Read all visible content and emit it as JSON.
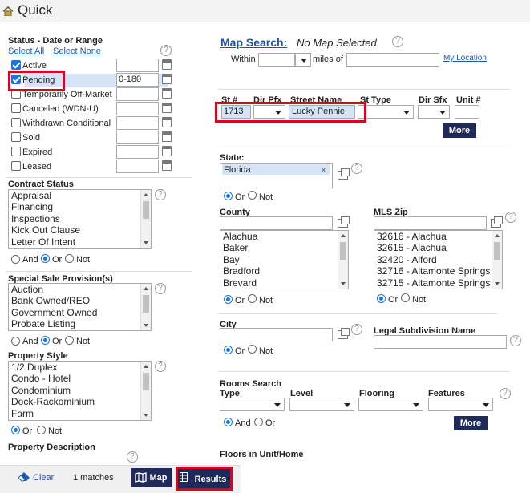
{
  "header": {
    "title": "Quick"
  },
  "status": {
    "title": "Status - Date or Range",
    "select_all": "Select All",
    "select_none": "Select None",
    "items": [
      {
        "label": "Active",
        "checked": true,
        "value": ""
      },
      {
        "label": "Pending",
        "checked": true,
        "value": "0-180"
      },
      {
        "label": "Temporarily Off-Market",
        "checked": false,
        "value": ""
      },
      {
        "label": "Canceled (WDN-U)",
        "checked": false,
        "value": ""
      },
      {
        "label": "Withdrawn Conditional",
        "checked": false,
        "value": ""
      },
      {
        "label": "Sold",
        "checked": false,
        "value": ""
      },
      {
        "label": "Expired",
        "checked": false,
        "value": ""
      },
      {
        "label": "Leased",
        "checked": false,
        "value": ""
      }
    ]
  },
  "contract_status": {
    "title": "Contract Status",
    "options": [
      "Appraisal",
      "Financing",
      "Inspections",
      "Kick Out Clause",
      "Letter Of Intent"
    ],
    "and": "And",
    "or": "Or",
    "not": "Not"
  },
  "special_sale": {
    "title": "Special Sale Provision(s)",
    "options": [
      "Auction",
      "Bank Owned/REO",
      "Government Owned",
      "Probate Listing"
    ],
    "and": "And",
    "or": "Or",
    "not": "Not"
  },
  "property_style": {
    "title": "Property Style",
    "options": [
      "1/2 Duplex",
      "Condo - Hotel",
      "Condominium",
      "Dock-Rackominium",
      "Farm"
    ],
    "or": "Or",
    "not": "Not"
  },
  "property_description": {
    "title": "Property Description"
  },
  "map_search": {
    "title": "Map Search:",
    "status": "No Map Selected",
    "within": "Within",
    "miles_of": "miles of",
    "my_location": "My Location"
  },
  "address": {
    "st_num_label": "St #",
    "st_num_value": "1713",
    "dir_pfx_label": "Dir Pfx",
    "street_name_label": "Street Name",
    "street_name_value": "Lucky Pennie",
    "st_type_label": "St Type",
    "dir_sfx_label": "Dir Sfx",
    "unit_label": "Unit #",
    "more": "More"
  },
  "state": {
    "label": "State:",
    "value": "Florida",
    "remove": "×",
    "or": "Or",
    "not": "Not"
  },
  "county": {
    "label": "County",
    "options": [
      "Alachua",
      "Baker",
      "Bay",
      "Bradford",
      "Brevard"
    ],
    "or": "Or",
    "not": "Not"
  },
  "mls_zip": {
    "label": "MLS Zip",
    "options": [
      "32616 - Alachua",
      "32615 - Alachua",
      "32420 - Alford",
      "32716 - Altamonte Springs",
      "32715 - Altamonte Springs"
    ],
    "or": "Or",
    "not": "Not"
  },
  "city": {
    "label": "City",
    "or": "Or",
    "not": "Not"
  },
  "legal_subdivision": {
    "label": "Legal Subdivision Name"
  },
  "rooms": {
    "title": "Rooms Search",
    "type": "Type",
    "level": "Level",
    "flooring": "Flooring",
    "features": "Features",
    "and": "And",
    "or": "Or",
    "more": "More"
  },
  "floors": {
    "label": "Floors in Unit/Home"
  },
  "footer": {
    "clear": "Clear",
    "matches": "1 matches",
    "map": "Map",
    "results": "Results"
  },
  "help_symbol": "?"
}
